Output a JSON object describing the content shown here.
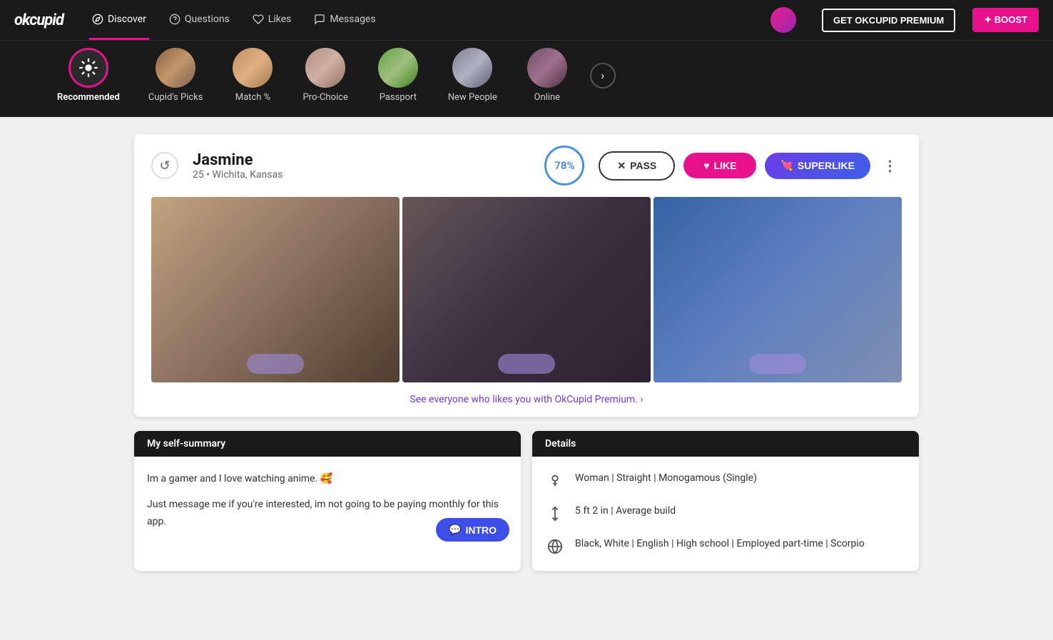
{
  "brand": "okcupid",
  "nav": {
    "items": [
      {
        "id": "discover",
        "label": "Discover",
        "active": true
      },
      {
        "id": "questions",
        "label": "Questions",
        "active": false
      },
      {
        "id": "likes",
        "label": "Likes",
        "active": false
      },
      {
        "id": "messages",
        "label": "Messages",
        "active": false
      }
    ],
    "premium_btn": "GET OKCUPID PREMIUM",
    "boost_btn": "✦ BOOST"
  },
  "categories": [
    {
      "id": "recommended",
      "label": "Recommended",
      "active": true
    },
    {
      "id": "cupids-picks",
      "label": "Cupid's Picks",
      "active": false
    },
    {
      "id": "match",
      "label": "Match %",
      "active": false
    },
    {
      "id": "pro-choice",
      "label": "Pro-Choice",
      "active": false
    },
    {
      "id": "passport",
      "label": "Passport",
      "active": false
    },
    {
      "id": "new-people",
      "label": "New People",
      "active": false
    },
    {
      "id": "online",
      "label": "Online",
      "active": false
    }
  ],
  "profile": {
    "name": "Jasmine",
    "age": "25",
    "location": "Wichita, Kansas",
    "match_percent": "78%",
    "premium_link": "See everyone who likes you with OkCupid Premium. ›",
    "pass_label": "PASS",
    "like_label": "LIKE",
    "superlike_label": "SUPERLIKE"
  },
  "self_summary": {
    "header": "My self-summary",
    "para1": "Im a gamer and I love watching anime. 🥰",
    "para2": "Just message me if you're interested, im not going to be paying monthly for this app.",
    "intro_btn": "INTRO"
  },
  "details": {
    "header": "Details",
    "rows": [
      {
        "icon": "♀",
        "text": "Woman | Straight | Monogamous (Single)"
      },
      {
        "icon": "↕",
        "text": "5 ft 2 in | Average build"
      },
      {
        "icon": "🌐",
        "text": "Black, White | English | High school | Employed part-time | Scorpio"
      }
    ]
  }
}
